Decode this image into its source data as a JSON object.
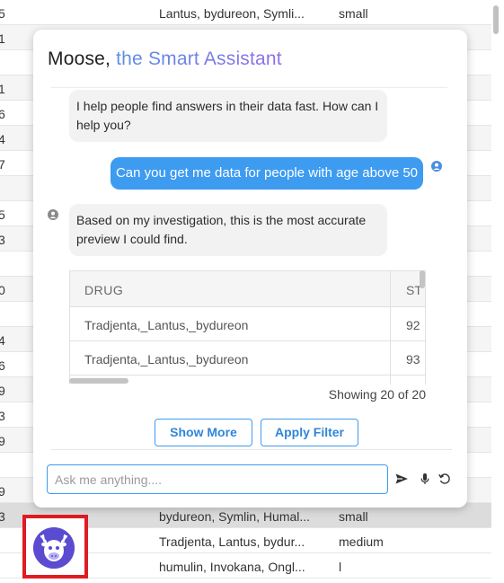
{
  "background_table": {
    "rows": [
      {
        "c0": "5",
        "drug": "Lantus, bydureon, Symli...",
        "size": "small",
        "style": "plain"
      },
      {
        "c0": "1",
        "drug": "",
        "size": "",
        "style": "alt"
      },
      {
        "c0": "",
        "drug": "",
        "size": "",
        "style": "plain"
      },
      {
        "c0": "1",
        "drug": "",
        "size": "",
        "style": "alt"
      },
      {
        "c0": "6",
        "drug": "",
        "size": "",
        "style": "plain"
      },
      {
        "c0": "4",
        "drug": "",
        "size": "",
        "style": "alt"
      },
      {
        "c0": "7",
        "drug": "",
        "size": "",
        "style": "plain"
      },
      {
        "c0": "",
        "drug": "",
        "size": "",
        "style": "alt"
      },
      {
        "c0": "5",
        "drug": "",
        "size": "",
        "style": "plain"
      },
      {
        "c0": "3",
        "drug": "",
        "size": "",
        "style": "alt"
      },
      {
        "c0": "",
        "drug": "",
        "size": "",
        "style": "plain"
      },
      {
        "c0": "0",
        "drug": "",
        "size": "",
        "style": "alt"
      },
      {
        "c0": "",
        "drug": "",
        "size": "",
        "style": "plain"
      },
      {
        "c0": "4",
        "drug": "",
        "size": "",
        "style": "alt"
      },
      {
        "c0": "6",
        "drug": "",
        "size": "",
        "style": "plain"
      },
      {
        "c0": "9",
        "drug": "",
        "size": "",
        "style": "alt"
      },
      {
        "c0": "3",
        "drug": "",
        "size": "",
        "style": "plain"
      },
      {
        "c0": "9",
        "drug": "",
        "size": "",
        "style": "alt"
      },
      {
        "c0": "",
        "drug": "",
        "size": "",
        "style": "plain"
      },
      {
        "c0": "9",
        "drug": "",
        "size": "",
        "style": "alt"
      },
      {
        "c0": "3",
        "drug": "bydureon, Symlin, Humal...",
        "size": "small",
        "style": "sel"
      },
      {
        "c0": "",
        "drug": "Tradjenta, Lantus, bydur...",
        "size": "medium",
        "style": "plain"
      },
      {
        "c0": "",
        "drug": "humulin, Invokana, Ongl...",
        "size": "l",
        "style": "plain"
      }
    ]
  },
  "chat": {
    "title_prefix": "Moose,",
    "title_accent": "the Smart Assistant",
    "accent_colors": [
      "#5a8fe6",
      "#8f6ee6"
    ],
    "messages": {
      "bot_greeting": "I help people find answers in their data fast. How can I help you?",
      "user_query": "Can you get me data for people with age above 50",
      "bot_reply": "Based on my investigation, this is the most accurate preview I could find."
    },
    "preview_table": {
      "headers": [
        "DRUG",
        "ST"
      ],
      "rows": [
        [
          "Tradjenta,_Lantus,_bydureon",
          "92"
        ],
        [
          "Tradjenta,_Lantus,_bydureon",
          "93"
        ]
      ]
    },
    "showing_text": "Showing 20 of 20",
    "show_more_label": "Show More",
    "apply_filter_label": "Apply Filter",
    "input_value": "",
    "input_placeholder": "Ask me anything....",
    "icons": {
      "send": "send-icon",
      "mic": "mic-icon",
      "reset": "reset-icon",
      "user_avatar": "user-avatar-icon",
      "bot_avatar": "bot-avatar-icon"
    }
  },
  "colors": {
    "primary": "#3d9bf0",
    "highlight_box": "#e01b22",
    "logo_bg": "#5b4bd1"
  }
}
